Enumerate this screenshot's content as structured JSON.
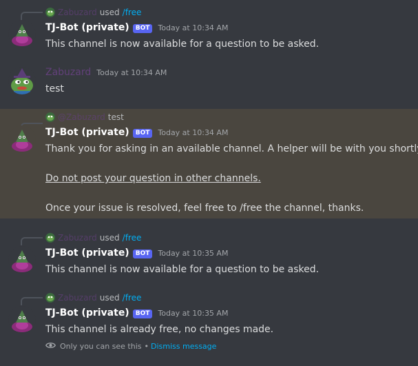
{
  "messages": [
    {
      "reply": {
        "name": "Zabuzard",
        "used": "used",
        "command": "/free"
      },
      "author": "TJ-Bot (private)",
      "tag": "BOT",
      "timestamp": "Today at 10:34 AM",
      "lines": [
        "This channel is now available for a question to be asked."
      ]
    },
    {
      "author": "Zabuzard",
      "timestamp": "Today at 10:34 AM",
      "lines": [
        "test"
      ]
    },
    {
      "reply": {
        "name": "@Zabuzard",
        "text": "test"
      },
      "author": "TJ-Bot (private)",
      "tag": "BOT",
      "timestamp": "Today at 10:34 AM",
      "lines": [
        "Thank you for asking in an available channel. A helper will be with you shortly!",
        "Do not post your question in other channels.",
        "Once your issue is resolved, feel free to /free the channel, thanks."
      ]
    },
    {
      "reply": {
        "name": "Zabuzard",
        "used": "used",
        "command": "/free"
      },
      "author": "TJ-Bot (private)",
      "tag": "BOT",
      "timestamp": "Today at 10:35 AM",
      "lines": [
        "This channel is now available for a question to be asked."
      ]
    },
    {
      "reply": {
        "name": "Zabuzard",
        "used": "used",
        "command": "/free"
      },
      "author": "TJ-Bot (private)",
      "tag": "BOT",
      "timestamp": "Today at 10:35 AM",
      "lines": [
        "This channel is already free, no changes made."
      ],
      "ephemeral": {
        "note": "Only you can see this",
        "separator": "•",
        "dismiss": "Dismiss message",
        "icon": "eye-icon"
      }
    }
  ],
  "colors": {
    "background": "#36393f",
    "highlight": "#4a463f",
    "bot_tag": "#5865f2",
    "link": "#00aff4",
    "user_name": "#62407a"
  }
}
